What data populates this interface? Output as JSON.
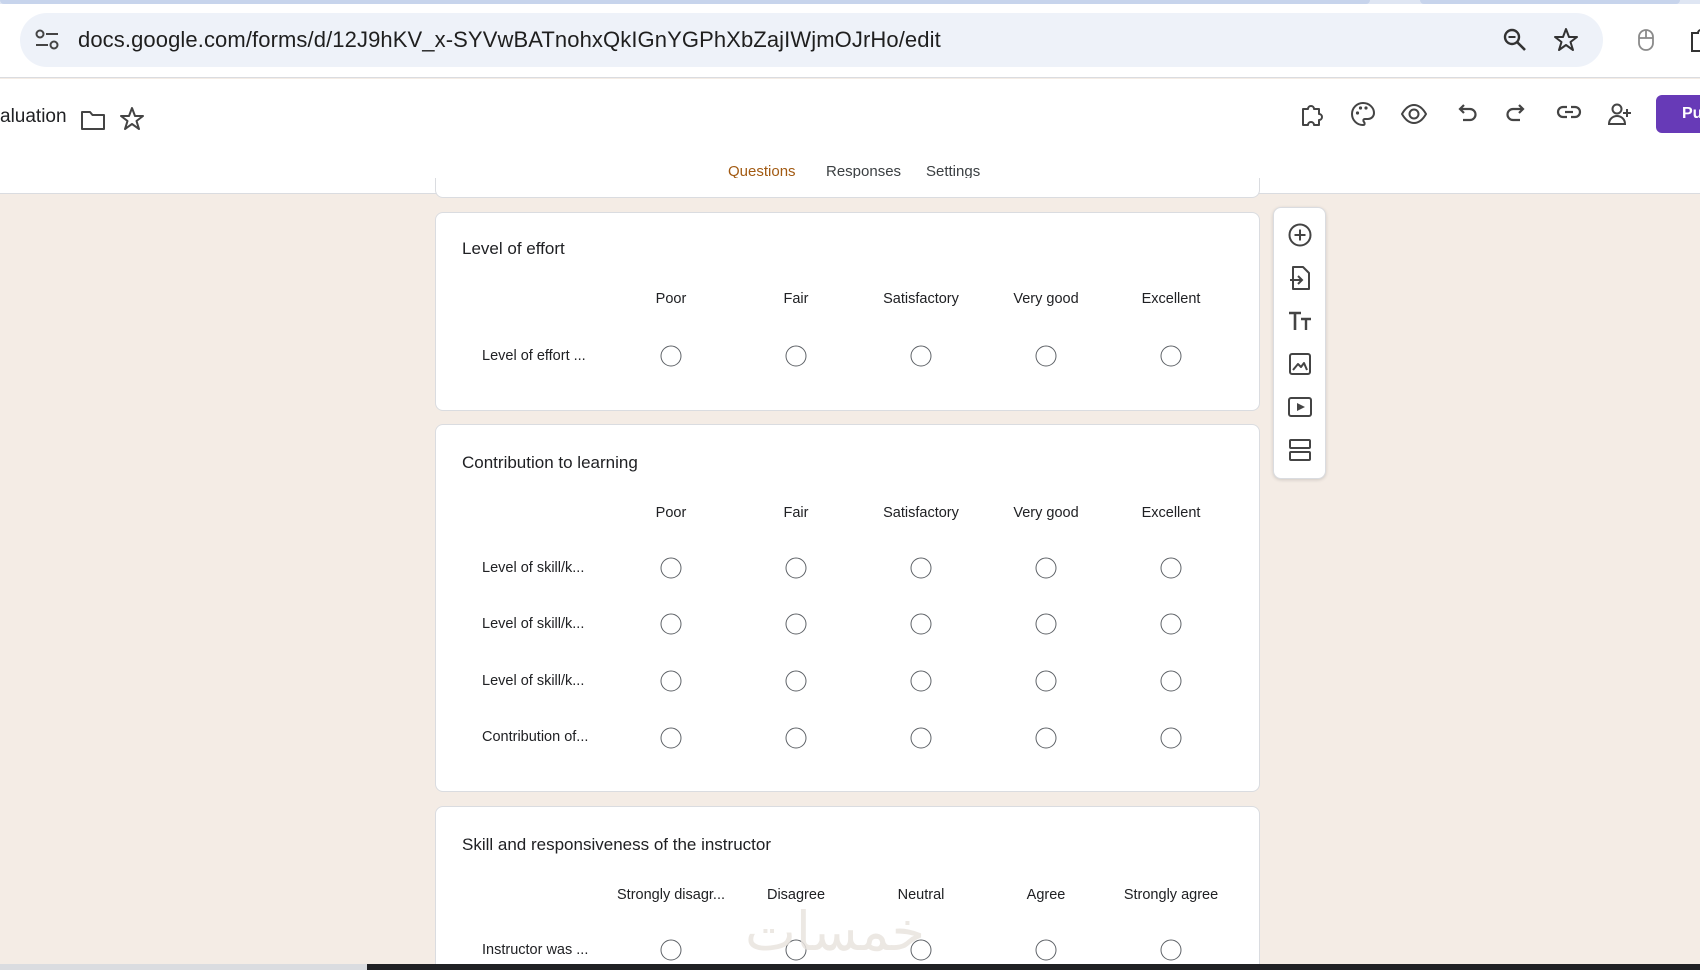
{
  "browser": {
    "url": "docs.google.com/forms/d/12J9hKV_x-SYVwBATnohxQkIGnYGPhXbZajIWjmOJrHo/edit"
  },
  "header": {
    "title": "aluation",
    "publish_label": "Pu"
  },
  "tabs": [
    {
      "label": "Questions",
      "active": true
    },
    {
      "label": "Responses",
      "active": false
    },
    {
      "label": "Settings",
      "active": false
    }
  ],
  "questions": [
    {
      "title": "Level of effort",
      "columns": [
        "Poor",
        "Fair",
        "Satisfactory",
        "Very good",
        "Excellent"
      ],
      "rows": [
        "Level of effort ..."
      ]
    },
    {
      "title": "Contribution to learning",
      "columns": [
        "Poor",
        "Fair",
        "Satisfactory",
        "Very good",
        "Excellent"
      ],
      "rows": [
        "Level of skill/k...",
        "Level of skill/k...",
        "Level of skill/k...",
        "Contribution of..."
      ]
    },
    {
      "title": "Skill and responsiveness of the instructor",
      "columns": [
        "Strongly disagr...",
        "Disagree",
        "Neutral",
        "Agree",
        "Strongly agree"
      ],
      "rows": [
        "Instructor was ..."
      ]
    }
  ],
  "watermark": "خمسات",
  "colors": {
    "accent": "#a25a12",
    "publish": "#673ab7",
    "background": "#f4ece5"
  }
}
